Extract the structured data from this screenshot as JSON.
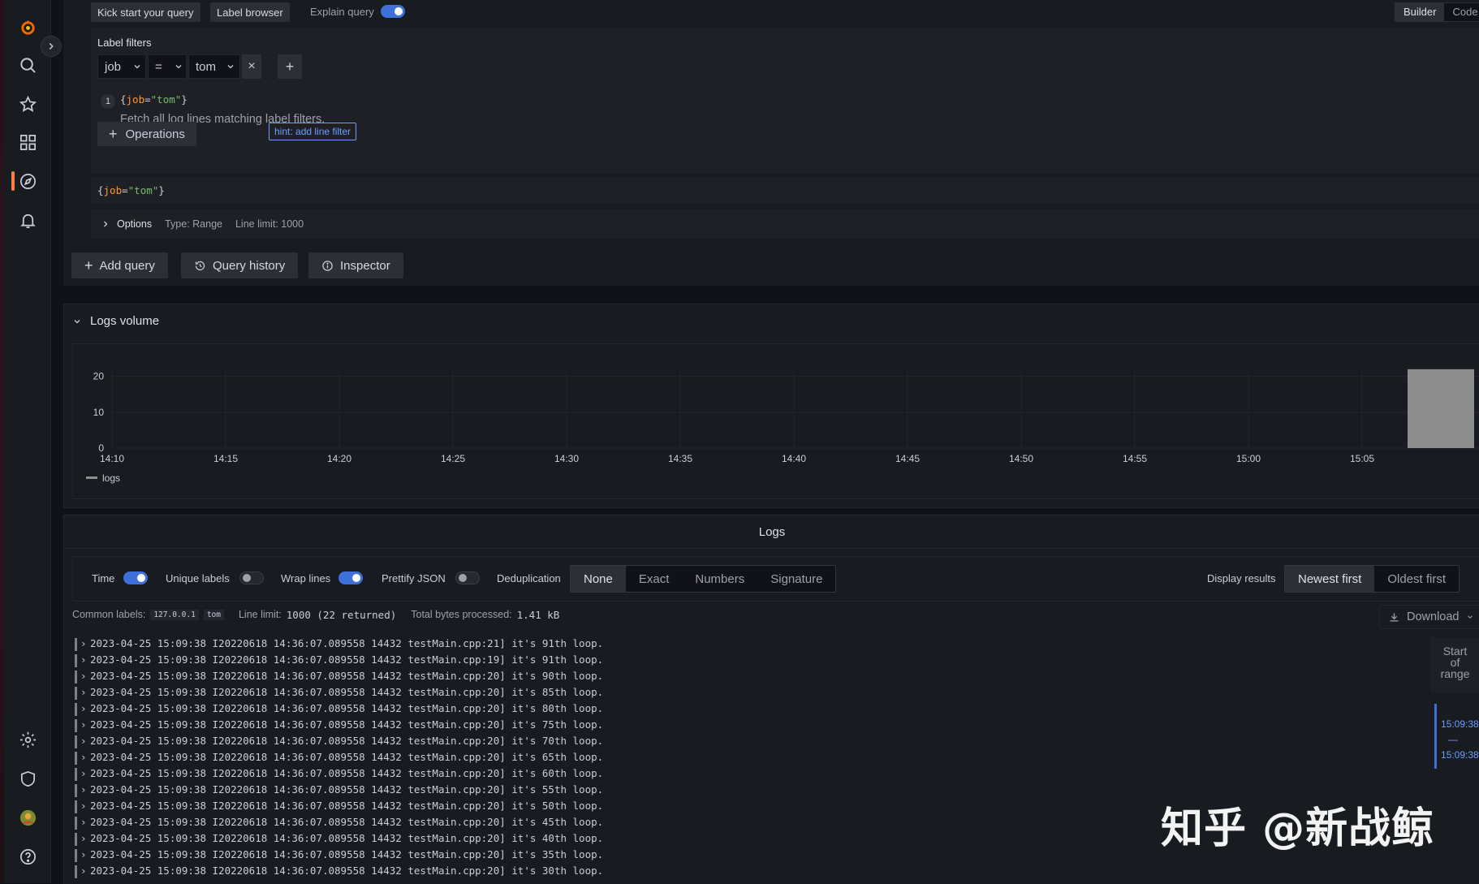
{
  "sidebar": {
    "icons": [
      "grafana-logo-icon",
      "search-icon",
      "star-icon",
      "dashboards-icon",
      "explore-icon",
      "alerting-icon",
      "settings-icon",
      "shield-icon",
      "avatar",
      "help-icon"
    ]
  },
  "toolbar": {
    "kick_start": "Kick start your query",
    "label_browser": "Label browser",
    "explain_query": "Explain query",
    "explain_query_on": true,
    "builder": "Builder",
    "code": "Code"
  },
  "label_filters": {
    "title": "Label filters",
    "label": "job",
    "operator": "=",
    "value": "tom",
    "remove": "×",
    "add": "+"
  },
  "query_step": {
    "number": "1",
    "expr_label": "job",
    "expr_value": "\"tom\"",
    "description": "Fetch all log lines matching label filters."
  },
  "operations_button": "Operations",
  "hint": "hint: add line filter",
  "query_preview": {
    "label": "job",
    "value": "\"tom\""
  },
  "options": {
    "label": "Options",
    "type": "Type: Range",
    "line_limit": "Line limit: 1000"
  },
  "actions": {
    "add_query": "Add query",
    "query_history": "Query history",
    "inspector": "Inspector"
  },
  "logs_volume": {
    "title": "Logs volume",
    "legend": "logs",
    "legend_color": "#8e8e8e"
  },
  "chart_data": {
    "type": "bar",
    "title": "",
    "xlabel": "",
    "ylabel": "",
    "x_ticks": [
      "14:10",
      "14:15",
      "14:20",
      "14:25",
      "14:30",
      "14:35",
      "14:40",
      "14:45",
      "14:50",
      "14:55",
      "15:00",
      "15:05"
    ],
    "y_ticks": [
      0,
      10,
      20
    ],
    "ylim": [
      0,
      24
    ],
    "series": [
      {
        "name": "logs",
        "color": "#8e8e8e",
        "points": [
          {
            "x_start": "15:07",
            "x_end": "15:11",
            "value": 22
          }
        ]
      }
    ],
    "grid": true,
    "legend": "bottom-left"
  },
  "logs": {
    "title": "Logs",
    "controls": {
      "time": "Time",
      "time_on": true,
      "unique_labels": "Unique labels",
      "unique_labels_on": false,
      "wrap_lines": "Wrap lines",
      "wrap_lines_on": true,
      "prettify_json": "Prettify JSON",
      "prettify_json_on": false,
      "deduplication": "Deduplication",
      "dedup_options": [
        "None",
        "Exact",
        "Numbers",
        "Signature"
      ],
      "dedup_selected": "None",
      "display_results": "Display results",
      "order_options": [
        "Newest first",
        "Oldest first"
      ],
      "order_selected": "Newest first"
    },
    "meta": {
      "common_labels": "Common labels:",
      "common_label_values": [
        "127.0.0.1",
        "tom"
      ],
      "line_limit_label": "Line limit:",
      "line_limit_value": "1000 (22 returned)",
      "total_bytes_label": "Total bytes processed:",
      "total_bytes_value": "1.41 kB"
    },
    "download": "Download",
    "range_title": "Start of range",
    "range_start": "15:09:38",
    "range_sep": "—",
    "range_end": "15:09:38",
    "lines": [
      "2023-04-25 15:09:38 I20220618 14:36:07.089558 14432 testMain.cpp:21] it's 91th loop.",
      "2023-04-25 15:09:38 I20220618 14:36:07.089558 14432 testMain.cpp:19] it's 91th loop.",
      "2023-04-25 15:09:38 I20220618 14:36:07.089558 14432 testMain.cpp:20] it's 90th loop.",
      "2023-04-25 15:09:38 I20220618 14:36:07.089558 14432 testMain.cpp:20] it's 85th loop.",
      "2023-04-25 15:09:38 I20220618 14:36:07.089558 14432 testMain.cpp:20] it's 80th loop.",
      "2023-04-25 15:09:38 I20220618 14:36:07.089558 14432 testMain.cpp:20] it's 75th loop.",
      "2023-04-25 15:09:38 I20220618 14:36:07.089558 14432 testMain.cpp:20] it's 70th loop.",
      "2023-04-25 15:09:38 I20220618 14:36:07.089558 14432 testMain.cpp:20] it's 65th loop.",
      "2023-04-25 15:09:38 I20220618 14:36:07.089558 14432 testMain.cpp:20] it's 60th loop.",
      "2023-04-25 15:09:38 I20220618 14:36:07.089558 14432 testMain.cpp:20] it's 55th loop.",
      "2023-04-25 15:09:38 I20220618 14:36:07.089558 14432 testMain.cpp:20] it's 50th loop.",
      "2023-04-25 15:09:38 I20220618 14:36:07.089558 14432 testMain.cpp:20] it's 45th loop.",
      "2023-04-25 15:09:38 I20220618 14:36:07.089558 14432 testMain.cpp:20] it's 40th loop.",
      "2023-04-25 15:09:38 I20220618 14:36:07.089558 14432 testMain.cpp:20] it's 35th loop.",
      "2023-04-25 15:09:38 I20220618 14:36:07.089558 14432 testMain.cpp:20] it's 30th loop."
    ]
  },
  "watermark": "知乎 @新战鲸"
}
